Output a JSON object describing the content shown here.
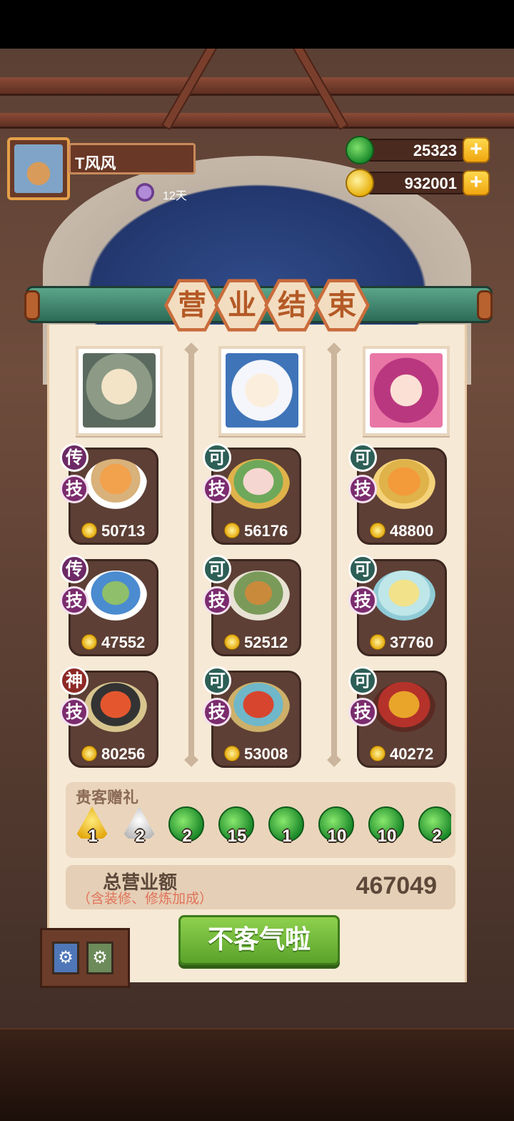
{
  "player": {
    "name": "T风风",
    "days": "12天"
  },
  "currency": {
    "jade": "25323",
    "gold": "932001"
  },
  "banner": {
    "chars": [
      "营",
      "业",
      "结",
      "束"
    ]
  },
  "columns": [
    {
      "dishes": [
        {
          "rank": "传",
          "skill": "技",
          "price": "50713"
        },
        {
          "rank": "传",
          "skill": "技",
          "price": "47552"
        },
        {
          "rank": "神",
          "skill": "技",
          "price": "80256"
        }
      ]
    },
    {
      "dishes": [
        {
          "rank": "可",
          "skill": "技",
          "price": "56176"
        },
        {
          "rank": "可",
          "skill": "技",
          "price": "52512"
        },
        {
          "rank": "可",
          "skill": "技",
          "price": "53008"
        }
      ]
    },
    {
      "dishes": [
        {
          "rank": "可",
          "skill": "技",
          "price": "48800"
        },
        {
          "rank": "可",
          "skill": "技",
          "price": "37760"
        },
        {
          "rank": "可",
          "skill": "技",
          "price": "40272"
        }
      ]
    }
  ],
  "gifts": {
    "title": "贵客赠礼",
    "items": [
      {
        "icon": "gold-dumpling-icon",
        "qty": "1"
      },
      {
        "icon": "silver-dumpling-icon",
        "qty": "2"
      },
      {
        "icon": "jade-icon",
        "qty": "2"
      },
      {
        "icon": "jade-icon",
        "qty": "15"
      },
      {
        "icon": "jade-icon",
        "qty": "1"
      },
      {
        "icon": "jade-icon",
        "qty": "10"
      },
      {
        "icon": "jade-icon",
        "qty": "10"
      },
      {
        "icon": "jade-icon",
        "qty": "2"
      }
    ]
  },
  "total": {
    "label": "总营业额",
    "sub": "（含装修、修炼加成）",
    "value": "467049"
  },
  "confirm_label": "不客气啦",
  "colors": {
    "accent_green": "#5aa22b",
    "gold": "#e6ac0d",
    "panel": "#f6e9d5"
  }
}
